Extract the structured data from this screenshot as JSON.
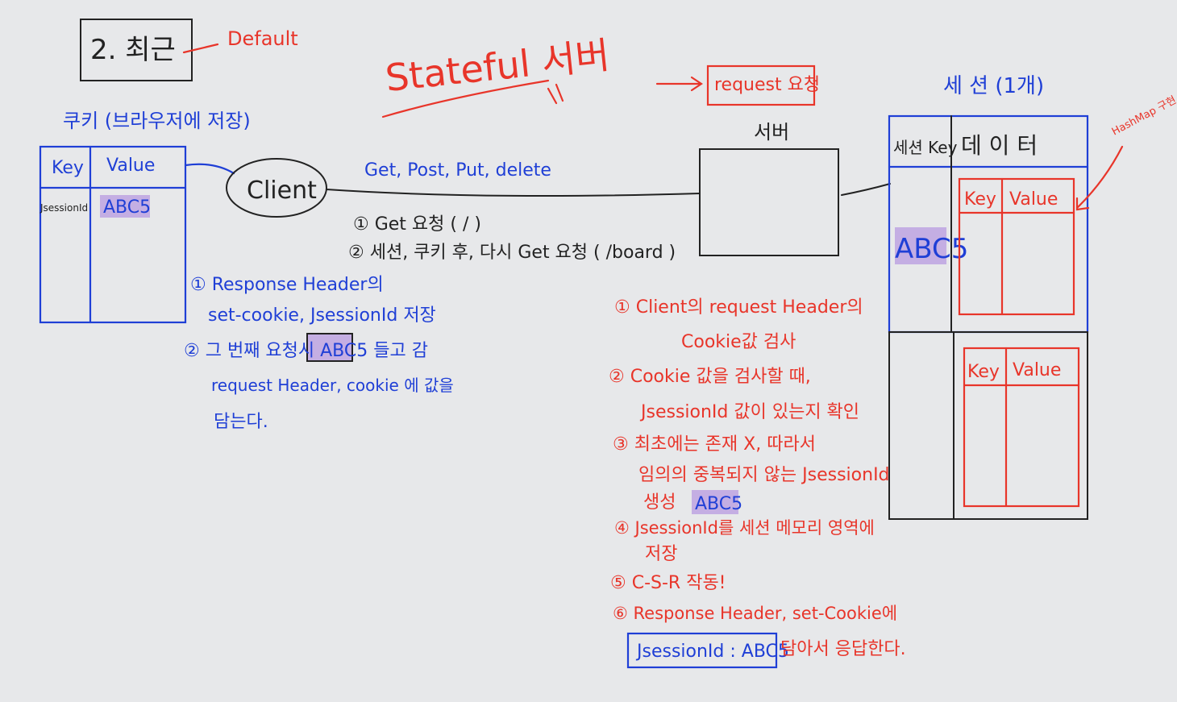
{
  "title": {
    "label": "2. 최근",
    "note": "Default"
  },
  "heading": "Stateful 서버",
  "cookie": {
    "title": "쿠키 (브라우저에 저장)",
    "header_key": "Key",
    "header_value": "Value",
    "row_key": "JsessionId",
    "row_value": "ABC5"
  },
  "client": {
    "label": "Client"
  },
  "methods": "Get, Post, Put, delete",
  "steps_top": [
    "① Get 요청 ( / )",
    "② 세션, 쿠키 후, 다시 Get 요청 ( /board )"
  ],
  "client_notes": [
    "① Response Header의",
    "set-cookie, JsessionId 저장",
    "② 그 번째 요청시 ABC5 들고 감",
    "request Header, cookie 에 값을",
    "담는다."
  ],
  "client_highlight": "ABC5",
  "server": {
    "label": "서버",
    "note": "request 요청"
  },
  "session": {
    "title": "세 션 (1개)",
    "col_key": "세션 Key",
    "col_data": "데 이 터",
    "row_key": "ABC5",
    "inner_key": "Key",
    "inner_value": "Value",
    "hashmap_note": "HashMap 구현"
  },
  "server_steps": [
    "① Client의 request Header의",
    "Cookie값 검사",
    "② Cookie 값을 검사할 때,",
    "JsessionId 값이 있는지 확인",
    "③ 최초에는 존재 X, 따라서",
    "임의의 중복되지 않는 JsessionId",
    "생성",
    "④ JsessionId를 세션 메모리 영역에",
    "저장",
    "⑤ C-S-R 작동!",
    "⑥ Response Header, set-Cookie에"
  ],
  "generated_value": "ABC5",
  "final_box": "JsessionId : ABC5",
  "final_note": "담아서 응답한다."
}
